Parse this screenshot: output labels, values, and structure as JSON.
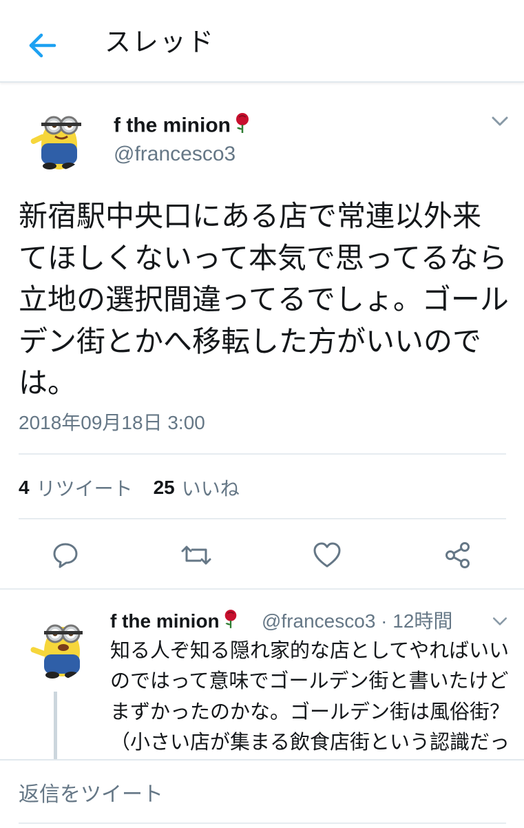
{
  "header": {
    "title": "スレッド",
    "back_icon": "arrow-left-icon",
    "accent_color": "#1da1f2"
  },
  "main_tweet": {
    "author": {
      "name": "f the minion",
      "handle": "@francesco3",
      "emoji_icon": "rose-icon",
      "avatar": "minion-avatar"
    },
    "text": "新宿駅中央口にある店で常連以外来てほしくないって本気で思ってるなら立地の選択間違ってるでしょ。ゴールデン街とかへ移転した方がいいのでは。",
    "timestamp": "2018年09月18日 3:00",
    "stats": {
      "retweets_count": "4",
      "retweets_label": "リツイート",
      "likes_count": "25",
      "likes_label": "いいね"
    },
    "actions": [
      "reply-icon",
      "retweet-icon",
      "like-icon",
      "share-icon"
    ]
  },
  "reply_tweet": {
    "author": {
      "name": "f the minion",
      "handle": "@francesco3",
      "emoji_icon": "rose-icon",
      "avatar": "minion-avatar"
    },
    "meta": "@francesco3 · 12時間",
    "text": "知る人ぞ知る隠れ家的な店としてやればいいのではって意味でゴールデン街と書いたけどまずかったのかな。ゴールデン街は風俗街？（小さい店が集まる飲食店街という認識だった）"
  },
  "compose": {
    "placeholder": "返信をツイート"
  }
}
